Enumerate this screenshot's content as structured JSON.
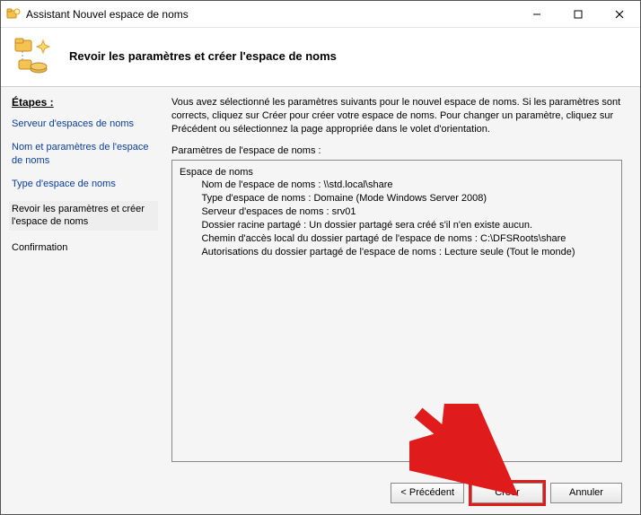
{
  "window": {
    "title": "Assistant Nouvel espace de noms"
  },
  "header": {
    "heading": "Revoir les paramètres et créer l'espace de noms"
  },
  "steps": {
    "title": "Étapes :",
    "items": [
      {
        "label": "Serveur d'espaces de noms",
        "active": false
      },
      {
        "label": "Nom et paramètres de l'espace de noms",
        "active": false
      },
      {
        "label": "Type d'espace de noms",
        "active": false
      },
      {
        "label": "Revoir les paramètres et créer l'espace de noms",
        "active": true
      },
      {
        "label": "Confirmation",
        "active": false
      }
    ]
  },
  "main": {
    "instructions": "Vous avez sélectionné les paramètres suivants pour le nouvel espace de noms. Si les paramètres sont corrects, cliquez sur Créer pour créer votre espace de noms. Pour changer un paramètre, cliquez sur Précédent ou sélectionnez la page appropriée dans le volet d'orientation.",
    "params_label": "Paramètres de l'espace de noms :",
    "params_text": "Espace de noms\n        Nom de l'espace de noms : \\\\std.local\\share\n        Type d'espace de noms : Domaine (Mode Windows Server 2008)\n        Serveur d'espaces de noms : srv01\n        Dossier racine partagé : Un dossier partagé sera créé s'il n'en existe aucun.\n        Chemin d'accès local du dossier partagé de l'espace de noms : C:\\DFSRoots\\share\n        Autorisations du dossier partagé de l'espace de noms : Lecture seule (Tout le monde)"
  },
  "footer": {
    "previous": "< Précédent",
    "create": "Créer",
    "cancel": "Annuler"
  }
}
